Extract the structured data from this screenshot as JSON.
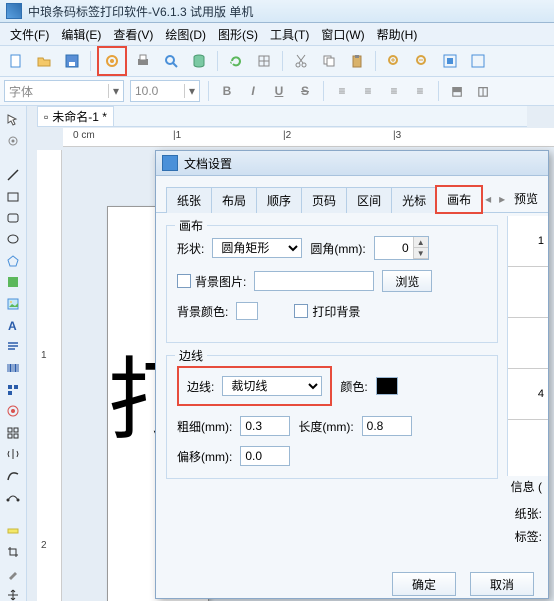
{
  "window": {
    "title": "中琅条码标签打印软件-V6.1.3 试用版 单机"
  },
  "menu": {
    "file": "文件(F)",
    "edit": "编辑(E)",
    "view": "查看(V)",
    "draw": "绘图(D)",
    "shape": "图形(S)",
    "tool": "工具(T)",
    "win": "窗口(W)",
    "help": "帮助(H)"
  },
  "fontbar": {
    "font_placeholder": "字体",
    "size": "10.0"
  },
  "doc": {
    "tab_label": "未命名-1 *"
  },
  "ruler": {
    "unit": "0 cm",
    "t1": "|1",
    "t2": "|2",
    "t3": "|3",
    "v1": "1",
    "v2": "2"
  },
  "dialog": {
    "title": "文档设置",
    "tabs": {
      "paper": "纸张",
      "layout": "布局",
      "order": "顺序",
      "page": "页码",
      "section": "区间",
      "cursor": "光标",
      "canvas": "画布"
    },
    "preview": "预览",
    "canvas_group": {
      "title": "画布",
      "shape_label": "形状:",
      "shape_value": "圆角矩形",
      "radius_label": "圆角(mm):",
      "radius_value": "0",
      "bgimg_label": "背景图片:",
      "browse": "浏览",
      "bgcolor_label": "背景颜色:",
      "printbg_label": "打印背景"
    },
    "edge_group": {
      "title": "边线",
      "edge_label": "边线:",
      "edge_value": "裁切线",
      "color_label": "颜色:",
      "thick_label": "粗细(mm):",
      "thick_value": "0.3",
      "length_label": "长度(mm):",
      "length_value": "0.8",
      "offset_label": "偏移(mm):",
      "offset_value": "0.0"
    },
    "info_label": "信息 (",
    "paper_label": "纸张:",
    "label_label": "标签:",
    "ok": "确定",
    "cancel": "取消"
  },
  "preview_cells": {
    "c1": "1",
    "c4": "4"
  }
}
